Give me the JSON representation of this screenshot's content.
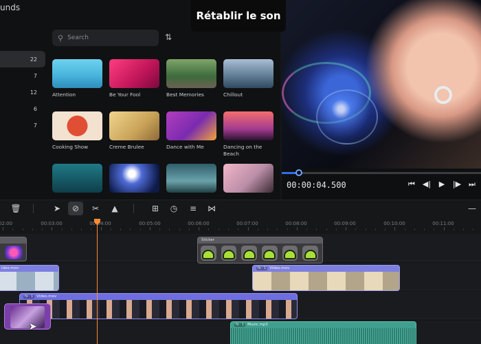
{
  "library": {
    "title_fragment": "unds",
    "category_counts": [
      "22",
      "7",
      "12",
      "6",
      "7"
    ],
    "search_placeholder": "Search",
    "tiles": [
      {
        "name": "Attention"
      },
      {
        "name": "Be Your Fool"
      },
      {
        "name": "Best Memories"
      },
      {
        "name": "Chillout"
      },
      {
        "name": "Cooking Show"
      },
      {
        "name": "Creme Brulee"
      },
      {
        "name": "Dance with Me"
      },
      {
        "name": "Dancing on the Beach"
      },
      {
        "name": ""
      },
      {
        "name": ""
      },
      {
        "name": ""
      },
      {
        "name": ""
      }
    ]
  },
  "preview": {
    "overlay_title": "Rétablir le son",
    "timecode": "00:00:04.500",
    "progress": 0.085
  },
  "timeline": {
    "ruler": [
      "02:00",
      "00:03:00",
      "00:04:00",
      "00:05:00",
      "00:06:00",
      "00:07:00",
      "00:08:00",
      "00:09:00",
      "00:10:00",
      "00:11:00"
    ],
    "clips": {
      "sticker": "Sticker",
      "video_left": "ideo.mov",
      "video_right": "Video.mov",
      "video_main": "Video.mov",
      "music": "Music.mp3",
      "fx": "fx · 1"
    }
  }
}
